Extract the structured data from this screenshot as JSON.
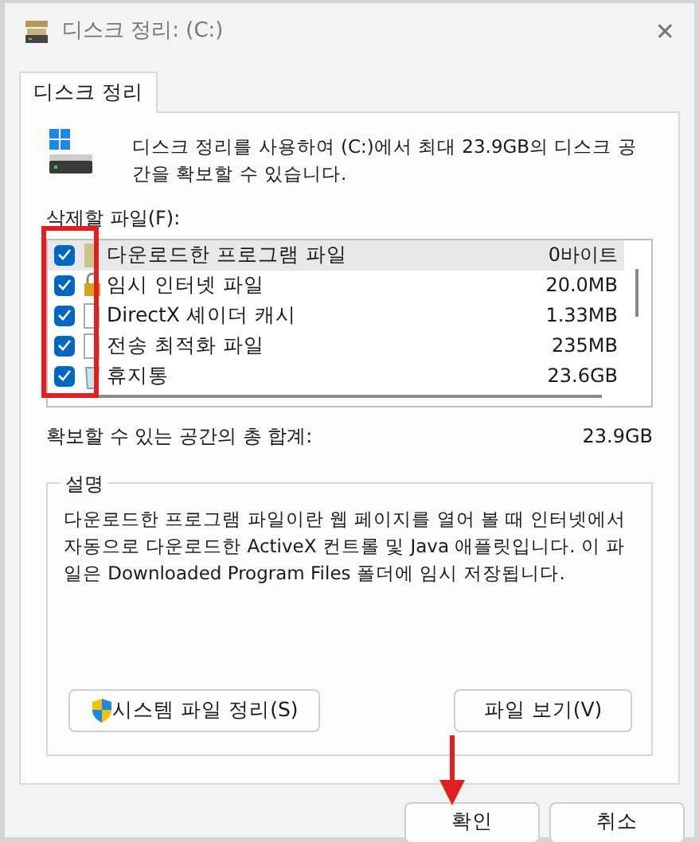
{
  "window": {
    "title": "디스크 정리: (C:)",
    "close": "✕"
  },
  "tabs": [
    {
      "label": "디스크 정리",
      "selected": true
    }
  ],
  "intro": "디스크 정리를 사용하여 (C:)에서 최대 23.9GB의 디스크 공간을 확보할 수 있습니다.",
  "files_label": "삭제할 파일(F):",
  "files": [
    {
      "name": "다운로드한 프로그램 파일",
      "size": "0바이트",
      "checked": true,
      "selected": true,
      "kind": "folder"
    },
    {
      "name": "임시 인터넷 파일",
      "size": "20.0MB",
      "checked": true,
      "selected": false,
      "kind": "lock"
    },
    {
      "name": "DirectX 셰이더 캐시",
      "size": "1.33MB",
      "checked": true,
      "selected": false,
      "kind": "file"
    },
    {
      "name": "전송 최적화 파일",
      "size": "235MB",
      "checked": true,
      "selected": false,
      "kind": "file"
    },
    {
      "name": "휴지통",
      "size": "23.6GB",
      "checked": true,
      "selected": false,
      "kind": "bin"
    }
  ],
  "total": {
    "label": "확보할 수 있는 공간의 총 합계:",
    "value": "23.9GB"
  },
  "description": {
    "legend": "설명",
    "text": "다운로드한 프로그램 파일이란 웹 페이지를 열어 볼 때 인터넷에서 자동으로 다운로드한 ActiveX 컨트롤 및 Java 애플릿입니다. 이 파일은 Downloaded Program Files 폴더에 임시 저장됩니다."
  },
  "panel_buttons": [
    {
      "label": "시스템 파일 정리(S)",
      "kind": "shield"
    },
    {
      "label": "파일 보기(V)",
      "kind": "plain"
    }
  ],
  "buttons": [
    "확인",
    "취소"
  ]
}
